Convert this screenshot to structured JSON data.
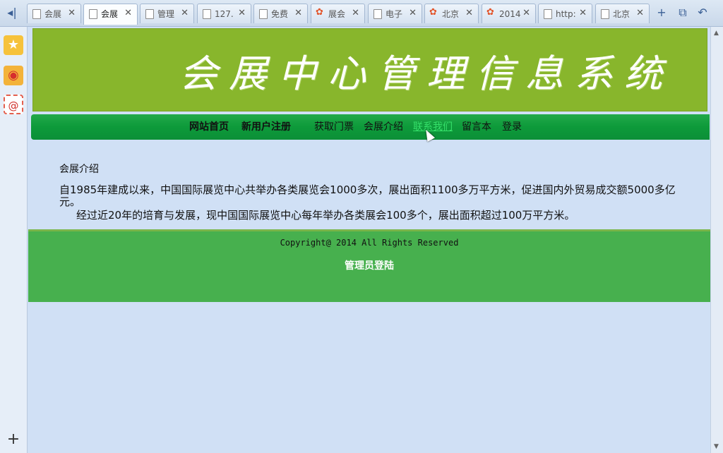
{
  "browser": {
    "tabs": [
      {
        "title": "会展",
        "icon": "page-icon",
        "active": false
      },
      {
        "title": "会展",
        "icon": "page-icon",
        "active": true
      },
      {
        "title": "管理",
        "icon": "page-icon",
        "active": false
      },
      {
        "title": "127.",
        "icon": "page-icon",
        "active": false
      },
      {
        "title": "免费",
        "icon": "page-icon",
        "active": false
      },
      {
        "title": "展会",
        "icon": "logo-icon",
        "active": false
      },
      {
        "title": "电子",
        "icon": "page-icon",
        "active": false
      },
      {
        "title": "北京",
        "icon": "logo-icon",
        "active": false
      },
      {
        "title": "2014",
        "icon": "logo-icon",
        "active": false
      },
      {
        "title": "http:",
        "icon": "page-icon",
        "active": false
      },
      {
        "title": "北京",
        "icon": "page-icon",
        "active": false
      }
    ],
    "close_glyph": "✕",
    "new_tab_glyph": "+",
    "restore_glyph": "⧉",
    "undo_glyph": "↶",
    "back_glyph": "◂|"
  },
  "sidebar": {
    "favorites_glyph": "★",
    "weibo_glyph": "◉",
    "mail_glyph": "@",
    "add_glyph": "+"
  },
  "page": {
    "banner_title": "会展中心管理信息系统",
    "nav": [
      {
        "label": "网站首页",
        "bold": true
      },
      {
        "label": "新用户注册",
        "bold": true
      },
      {
        "label": "获取门票",
        "bold": false
      },
      {
        "label": "会展介绍",
        "bold": false
      },
      {
        "label": "联系我们",
        "bold": false,
        "hover": true
      },
      {
        "label": "留言本",
        "bold": false
      },
      {
        "label": "登录",
        "bold": false
      }
    ],
    "section_title": "会展介绍",
    "paragraph1": "自1985年建成以来，中国国际展览中心共举办各类展览会1000多次，展出面积1100多万平方米，促进国内外贸易成交额5000多亿元。",
    "paragraph2": "经过近20年的培育与发展，现中国国际展览中心每年举办各类展会100多个，展出面积超过100万平方米。",
    "copyright": "Copyright@ 2014 All Rights Reserved",
    "admin_login": "管理员登陆"
  },
  "colors": {
    "banner": "#88b62c",
    "navbar": "#0d9a3a",
    "footer": "#47b04e",
    "page_bg": "#d0e0f5",
    "nav_hover": "#36e06a"
  }
}
